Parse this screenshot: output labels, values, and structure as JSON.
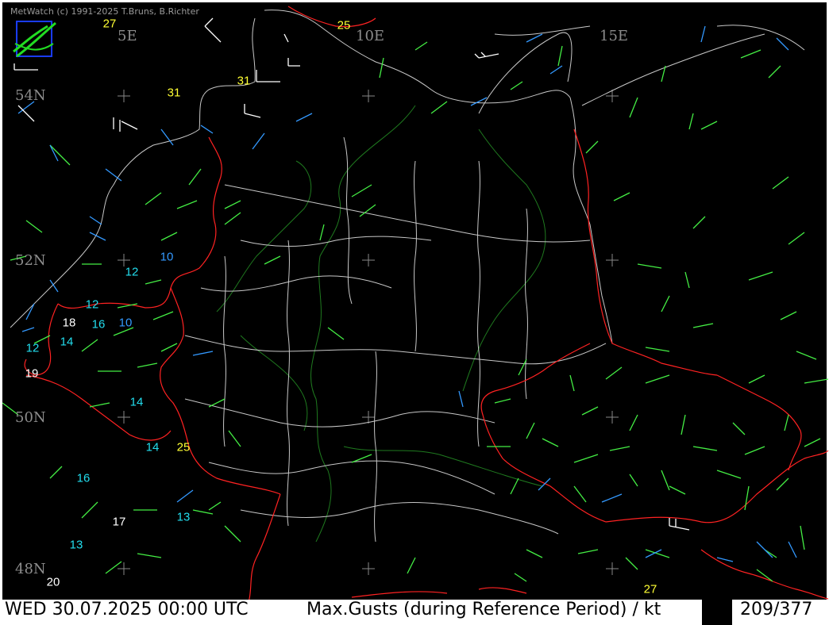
{
  "credit": "MetWatch  (c) 1991-2025 T.Bruns, B.Richter",
  "lon_labels": [
    {
      "text": "5E"
    },
    {
      "text": "10E"
    },
    {
      "text": "15E"
    }
  ],
  "lat_labels": [
    {
      "text": "54N"
    },
    {
      "text": "52N"
    },
    {
      "text": "50N"
    },
    {
      "text": "48N"
    }
  ],
  "gust_colors": {
    "yellow": "#ffff33",
    "cyan": "#22ddee",
    "blue": "#3399ff",
    "white": "#ffffff"
  },
  "gust_values": [
    {
      "value": "27",
      "color": "yellow"
    },
    {
      "value": "25",
      "color": "yellow"
    },
    {
      "value": "31",
      "color": "yellow"
    },
    {
      "value": "31",
      "color": "yellow"
    },
    {
      "value": "10",
      "color": "blue"
    },
    {
      "value": "12",
      "color": "cyan"
    },
    {
      "value": "12",
      "color": "cyan"
    },
    {
      "value": "18",
      "color": "white"
    },
    {
      "value": "16",
      "color": "cyan"
    },
    {
      "value": "10",
      "color": "blue"
    },
    {
      "value": "14",
      "color": "cyan"
    },
    {
      "value": "12",
      "color": "cyan"
    },
    {
      "value": "19",
      "color": "white"
    },
    {
      "value": "14",
      "color": "cyan"
    },
    {
      "value": "14",
      "color": "cyan"
    },
    {
      "value": "25",
      "color": "yellow"
    },
    {
      "value": "16",
      "color": "cyan"
    },
    {
      "value": "13",
      "color": "cyan"
    },
    {
      "value": "17",
      "color": "white"
    },
    {
      "value": "13",
      "color": "cyan"
    },
    {
      "value": "20",
      "color": "white"
    },
    {
      "value": "27",
      "color": "yellow"
    }
  ],
  "map_colors": {
    "background": "#000000",
    "coast": "#c8c8c8",
    "border": "#ff2222",
    "rivers": "#1f7a1f",
    "wind_green": "#44ee44",
    "wind_blue": "#3399ff",
    "wind_white": "#ffffff",
    "grid_cross": "#888888"
  },
  "status": {
    "datetime": "WED 30.07.2025 00:00 UTC",
    "product": "Max.Gusts (during Reference Period) / kt",
    "counter": "209/377"
  }
}
